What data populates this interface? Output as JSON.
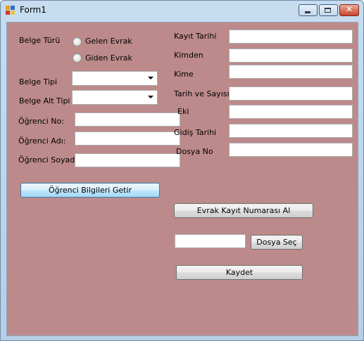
{
  "window": {
    "title": "Form1"
  },
  "form": {
    "belge_turu_label": "Belge Türü",
    "radio_gelen": "Gelen Evrak",
    "radio_giden": "Giden Evrak",
    "belge_tipi_label": "Belge Tipi",
    "belge_tipi_value": "",
    "belge_alt_tipi_label": "Belge Alt Tipi",
    "belge_alt_tipi_value": "",
    "ogrenci_no_label": "Öğrenci No:",
    "ogrenci_no_value": "",
    "ogrenci_adi_label": "Öğrenci Adı:",
    "ogrenci_adi_value": "",
    "ogrenci_soyadi_label": "Öğrenci Soyadı:",
    "ogrenci_soyadi_value": "",
    "ogrenci_getir_button": "Öğrenci Bilgileri Getir",
    "kayit_tarihi_label": "Kayıt Tarihi",
    "kayit_tarihi_value": "",
    "kimden_label": "Kimden",
    "kimden_value": "",
    "kime_label": "Kime",
    "kime_value": "",
    "tarih_sayisi_label": "Tarih ve Sayısı",
    "tarih_sayisi_value": "",
    "eki_label": "Eki",
    "eki_value": "",
    "gidis_tarihi_label": "Gidiş Tarihi",
    "gidis_tarihi_value": "",
    "dosya_no_label": "Dosya No",
    "dosya_no_value": "",
    "evrak_kayit_button": "Evrak Kayıt Numarası Al",
    "dosya_path_value": "",
    "dosya_sec_button": "Dosya Seç",
    "kaydet_button": "Kaydet"
  },
  "colors": {
    "form_background": "#bc8a8a",
    "window_frame": "#c7dcef",
    "close_button": "#c9432d"
  }
}
